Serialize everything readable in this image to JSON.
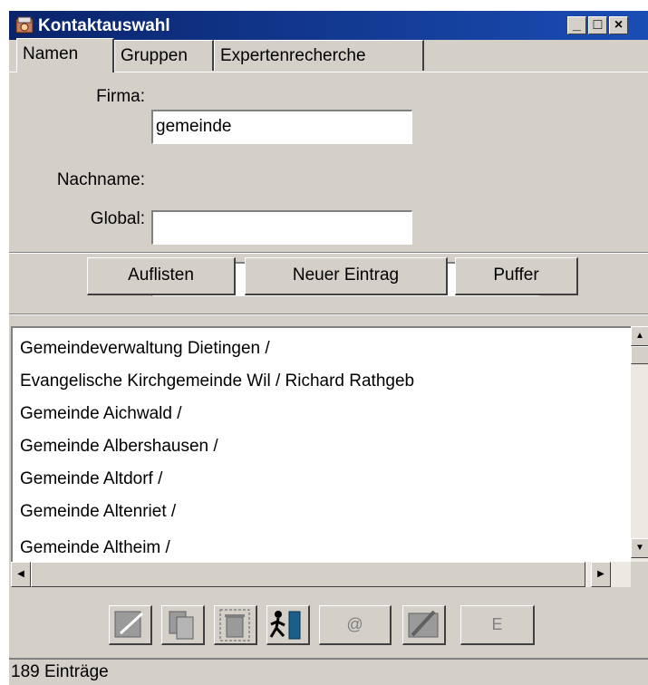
{
  "window": {
    "title": "Kontaktauswahl",
    "controls": {
      "minimize": "_",
      "maximize": "□",
      "close": "×"
    }
  },
  "tabs": [
    "Namen",
    "Gruppen",
    "Expertenrecherche"
  ],
  "active_tab": "Namen",
  "form": {
    "firma_label": "Firma:",
    "firma_value": "gemeinde",
    "nachname_label": "Nachname:",
    "nachname_value": "",
    "global_label": "Global:",
    "global_value": ""
  },
  "buttons": {
    "auflisten": "Auflisten",
    "neuer_eintrag": "Neuer Eintrag",
    "puffer": "Puffer"
  },
  "results": [
    " Gemeindeverwaltung Dietingen  /",
    "Evangelische Kirchgemeinde Wil / Richard  Rathgeb",
    "Gemeinde Aichwald /",
    "Gemeinde Albershausen /",
    "Gemeinde Altdorf /",
    "Gemeinde Altenriet /",
    "Gemeinde Altheim /"
  ],
  "toolbar": {
    "icons": [
      "edit-icon",
      "copy-icon",
      "delete-icon",
      "exit-icon",
      "email-icon",
      "write-icon",
      "e-icon"
    ],
    "email_label": "@",
    "e_label": "E"
  },
  "status": {
    "text": "189 Einträge"
  },
  "colors": {
    "titlebar": "#0a246a",
    "face": "#d4d0c8",
    "exit_icon": "#006600"
  }
}
